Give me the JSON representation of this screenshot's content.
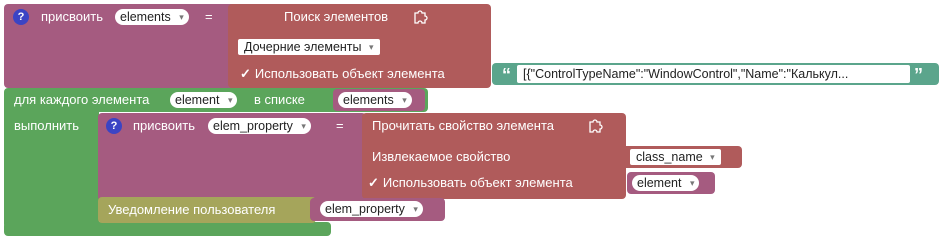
{
  "blocks": {
    "assign1": {
      "keyword": "присвоить",
      "variable": "elements",
      "equals": "="
    },
    "find": {
      "title": "Поиск элементов",
      "scope": "Дочерние элементы",
      "use_object_label": "Использовать объект элемента"
    },
    "json_text": "[{\"ControlTypeName\":\"WindowControl\",\"Name\":\"Калькул...",
    "foreach": {
      "prefix": "для каждого элемента",
      "variable": "element",
      "in_list": "в списке",
      "list": "elements",
      "do": "выполнить"
    },
    "assign2": {
      "keyword": "присвоить",
      "variable": "elem_property",
      "equals": "="
    },
    "read": {
      "title": "Прочитать свойство элемента",
      "property_label": "Извлекаемое свойство",
      "property_value": "class_name",
      "use_object_label": "Использовать объект элемента",
      "object_value": "element"
    },
    "notify": {
      "label": "Уведомление пользователя",
      "value": "elem_property"
    }
  },
  "icons": {
    "help": "?",
    "check": "✓",
    "dropdown": "▾",
    "quote_open": "“",
    "quote_close": "”"
  },
  "colors": {
    "variables": "#a55b80",
    "actions": "#b05b5b",
    "loop": "#5ba55b",
    "text": "#5ba58c",
    "notify": "#a5a55b",
    "help": "#3b44c4"
  }
}
